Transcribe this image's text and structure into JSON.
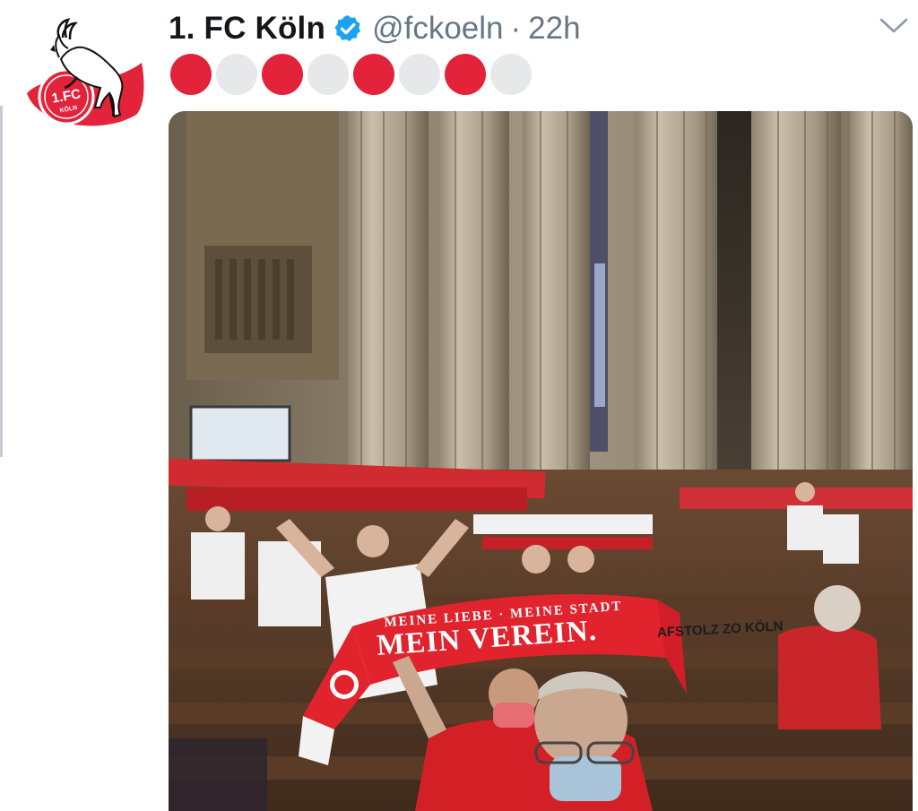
{
  "tweet": {
    "display_name": "1. FC Köln",
    "handle": "@fckoeln",
    "separator": "·",
    "timestamp": "22h",
    "verified": true,
    "dots": [
      {
        "color": "#e2233a"
      },
      {
        "color": "#e6e8ea"
      },
      {
        "color": "#e2233a"
      },
      {
        "color": "#e6e8ea"
      },
      {
        "color": "#e2233a"
      },
      {
        "color": "#e6e8ea"
      },
      {
        "color": "#e2233a"
      },
      {
        "color": "#e6e8ea"
      }
    ],
    "avatar": {
      "icon": "fc-koeln-goat-logo",
      "badge_text": "1.FC",
      "badge_subtext": "KÖLN"
    },
    "menu_icon": "chevron-down-icon"
  },
  "media": {
    "scarf_small_text": "MEINE LIEBE · MEINE STADT",
    "scarf_big_text": "MEIN VEREIN.",
    "top_scarf_text": "AFSTOLZ ZO KÖLN"
  },
  "colors": {
    "accent_red": "#e2233a",
    "dot_grey": "#e6e8ea",
    "verified_blue": "#1da1f2",
    "text_primary": "#14171a",
    "text_secondary": "#657786"
  }
}
